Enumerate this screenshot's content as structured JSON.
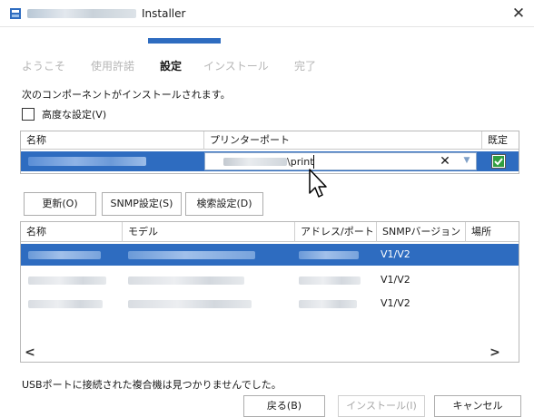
{
  "window": {
    "title": "Installer",
    "close_glyph": "✕"
  },
  "steps": [
    {
      "label": "ようこそ",
      "active": false
    },
    {
      "label": "使用許諾",
      "active": false
    },
    {
      "label": "設定",
      "active": true
    },
    {
      "label": "インストール",
      "active": false
    },
    {
      "label": "完了",
      "active": false
    }
  ],
  "description": "次のコンポーネントがインストールされます。",
  "advanced": {
    "label": "高度な設定(V)",
    "checked": false
  },
  "components_table": {
    "headers": {
      "name": "名称",
      "port": "プリンターポート",
      "default": "既定"
    },
    "row": {
      "port_value": "\\print",
      "clear_glyph": "✕",
      "default_checked": true
    }
  },
  "buttons": {
    "refresh": "更新(O)",
    "snmp_settings": "SNMP設定(S)",
    "search_settings": "検索設定(D)"
  },
  "devices_table": {
    "headers": {
      "name": "名称",
      "model": "モデル",
      "address": "アドレス/ポート",
      "snmp": "SNMPバージョン",
      "location": "場所"
    },
    "rows": [
      {
        "snmp": "V1/V2",
        "selected": true
      },
      {
        "snmp": "V1/V2",
        "selected": false
      },
      {
        "snmp": "V1/V2",
        "selected": false
      }
    ],
    "scroll_left": "<",
    "scroll_right": ">"
  },
  "usb_message": "USBポートに接続された複合機は見つかりませんでした。",
  "footer": {
    "back": "戻る(B)",
    "install": "インストール(I)",
    "cancel": "キャンセル"
  },
  "colors": {
    "accent": "#2e6cc0",
    "check_green": "#2f9e3f"
  }
}
